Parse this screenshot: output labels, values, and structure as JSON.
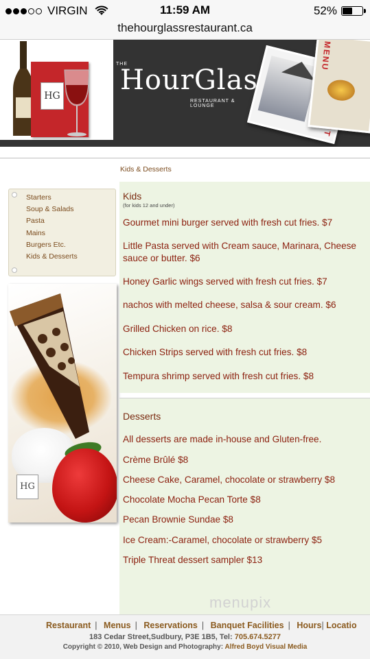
{
  "status_bar": {
    "carrier": "VIRGIN",
    "time": "11:59 AM",
    "battery": "52%",
    "battery_level": 0.52,
    "signal_bars": 3
  },
  "url": "thehourglassrestaurant.ca",
  "logo": {
    "the": "THE",
    "name": "HourGlass",
    "tagline": "RESTAURANT & LOUNGE"
  },
  "breadcrumb": "Kids & Desserts",
  "sidebar": {
    "items": [
      "Starters",
      "Soup & Salads",
      "Pasta",
      "Mains",
      "Burgers Etc.",
      "Kids & Desserts"
    ]
  },
  "kids": {
    "heading": "Kids",
    "note": "(for kids 12 and under)",
    "items": [
      "Gourmet mini burger served with fresh cut fries. $7",
      "Little Pasta served with Cream sauce, Marinara, Cheese sauce or butter. $6",
      "Honey Garlic wings served with fresh cut fries. $7",
      "nachos with melted cheese, salsa & sour cream. $6",
      "Grilled Chicken on rice. $8",
      "Chicken Strips served with fresh cut fries. $8",
      "Tempura shrimp served with fresh cut fries. $8"
    ]
  },
  "desserts": {
    "heading": "Desserts",
    "items": [
      "All desserts are made in-house and Gluten-free.",
      "Crème Brûlé $8",
      "Cheese Cake, Caramel, chocolate or strawberry $8",
      "Chocolate Mocha Pecan Torte $8",
      "Pecan Brownie Sundae $8",
      "Ice Cream:-Caramel, chocolate or strawberry $5",
      "Triple Threat dessert sampler $13"
    ]
  },
  "watermark": "menupix",
  "footer": {
    "nav": [
      "Restaurant",
      "Menus",
      "Reservations",
      "Banquet Facilities",
      "Hours",
      "Locatio"
    ],
    "address": "183 Cedar Street,Sudbury, P3E 1B5, Tel:",
    "phone": "705.674.5277",
    "copyright": "Copyright © 2010, Web Design and Photography:",
    "credit": "Alfred Boyd Visual Media"
  },
  "colors": {
    "link": "#7a4a1c",
    "menu_item": "#8b1f0e",
    "panel_bg": "#edf4e3",
    "sidebar_bg": "#f2efe1"
  }
}
